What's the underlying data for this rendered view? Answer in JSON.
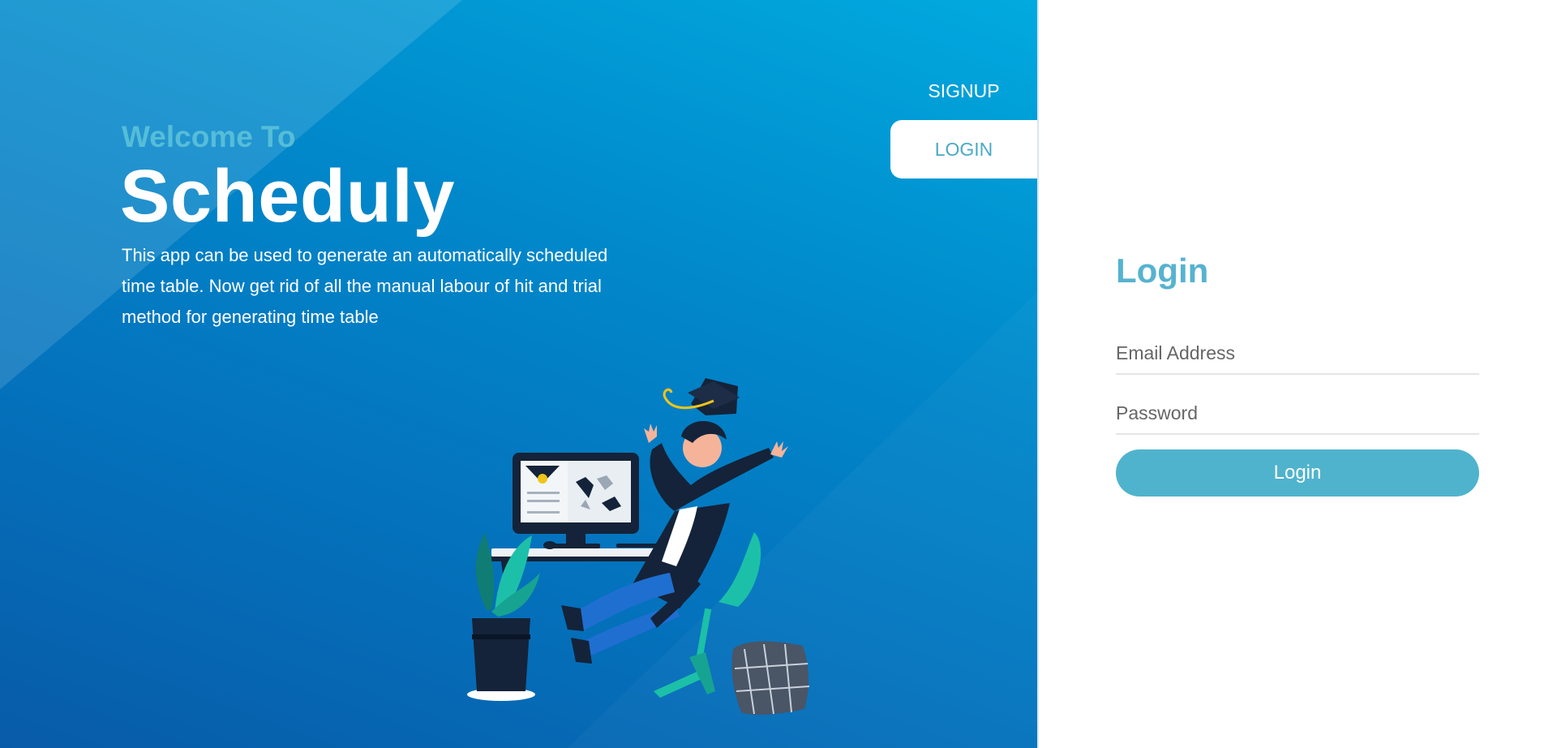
{
  "hero": {
    "welcome": "Welcome To",
    "brand": "Scheduly",
    "tagline": "This app can be used to generate an automatically scheduled time table. Now get rid of all the manual labour of hit and trial method for generating time table"
  },
  "nav": {
    "signup_label": "SIGNUP",
    "login_label": "LOGIN",
    "active_tab": "LOGIN"
  },
  "login_form": {
    "title": "Login",
    "email_placeholder": "Email Address",
    "email_value": "",
    "password_placeholder": "Password",
    "password_value": "",
    "submit_label": "Login"
  },
  "colors": {
    "hero_gradient_start": "#01aadf",
    "hero_gradient_end": "#085ba8",
    "accent": "#4fb3cd",
    "welcome_text": "#56bdd9"
  },
  "icons": {
    "illustration": "graduate-celebrating-illustration"
  }
}
